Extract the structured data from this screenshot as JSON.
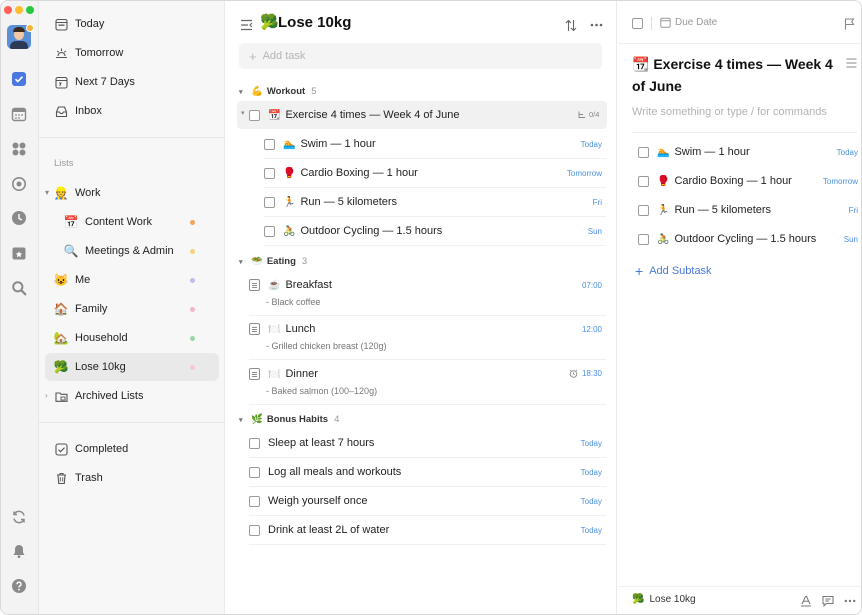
{
  "sidebar": {
    "smart": [
      {
        "label": "Today"
      },
      {
        "label": "Tomorrow"
      },
      {
        "label": "Next 7 Days"
      },
      {
        "label": "Inbox"
      }
    ],
    "section_label": "Lists",
    "work_folder": {
      "label": "Work",
      "emoji": "👷"
    },
    "work_children": [
      {
        "label": "Content Work",
        "emoji": "📅",
        "dot": "#f0a45c"
      },
      {
        "label": "Meetings & Admin",
        "emoji": "🔍",
        "dot": "#f4d47b"
      }
    ],
    "lists": [
      {
        "label": "Me",
        "emoji": "😺",
        "dot": "#c8b7f2"
      },
      {
        "label": "Family",
        "emoji": "🏠",
        "dot": "#f2b6c6"
      },
      {
        "label": "Household",
        "emoji": "🏡",
        "dot": "#9ad6a8"
      },
      {
        "label": "Lose 10kg",
        "emoji": "🥦",
        "dot": "#f5c8d0"
      }
    ],
    "archived": {
      "label": "Archived Lists"
    },
    "bottom": [
      {
        "label": "Completed"
      },
      {
        "label": "Trash"
      }
    ]
  },
  "main": {
    "title": "Lose 10kg",
    "title_emoji": "🥦",
    "add_placeholder": "Add task",
    "groups": [
      {
        "name": "Workout",
        "emoji": "💪",
        "count": "5"
      },
      {
        "name": "Eating",
        "emoji": "🥗",
        "count": "3"
      },
      {
        "name": "Bonus Habits",
        "emoji": "🌿",
        "count": "4"
      }
    ],
    "workout_parent": {
      "title": "Exercise 4 times — Week 4 of June",
      "emoji": "📆",
      "progress": "0/4"
    },
    "workout_subs": [
      {
        "title": "Swim — 1 hour",
        "emoji": "🏊",
        "date": "Today"
      },
      {
        "title": "Cardio Boxing — 1 hour",
        "emoji": "🥊",
        "date": "Tomorrow"
      },
      {
        "title": "Run — 5 kilometers",
        "emoji": "🏃",
        "date": "Fri"
      },
      {
        "title": "Outdoor Cycling — 1.5 hours",
        "emoji": "🚴",
        "date": "Sun"
      }
    ],
    "eating": [
      {
        "title": "Breakfast",
        "emoji": "☕",
        "note": "- Black coffee",
        "time": "07:00"
      },
      {
        "title": "Lunch",
        "emoji": "🍽️",
        "note": "- Grilled chicken breast (120g)",
        "time": "12:00"
      },
      {
        "title": "Dinner",
        "emoji": "🍽️",
        "note": "- Baked salmon (100–120g)",
        "time": "18:30"
      }
    ],
    "bonus": [
      {
        "title": "Sleep at least 7 hours",
        "date": "Today"
      },
      {
        "title": "Log all meals and workouts",
        "date": "Today"
      },
      {
        "title": "Weigh yourself once",
        "date": "Today"
      },
      {
        "title": "Drink at least 2L of water",
        "date": "Today"
      }
    ]
  },
  "detail": {
    "due_label": "Due Date",
    "title_emoji": "📆",
    "title": "Exercise 4 times — Week 4 of June",
    "placeholder": "Write something or type / for commands",
    "subtasks": [
      {
        "title": "Swim — 1 hour",
        "emoji": "🏊",
        "date": "Today"
      },
      {
        "title": "Cardio Boxing — 1 hour",
        "emoji": "🥊",
        "date": "Tomorrow"
      },
      {
        "title": "Run — 5 kilometers",
        "emoji": "🏃",
        "date": "Fri"
      },
      {
        "title": "Outdoor Cycling — 1.5 hours",
        "emoji": "🚴",
        "date": "Sun"
      }
    ],
    "add_subtask": "Add Subtask",
    "footer_list": "Lose 10kg",
    "footer_emoji": "🥦"
  },
  "colors": {
    "accent": "#4a90e2",
    "traffic_red": "#ff5f57",
    "traffic_yellow": "#febc2e",
    "traffic_green": "#28c840"
  }
}
